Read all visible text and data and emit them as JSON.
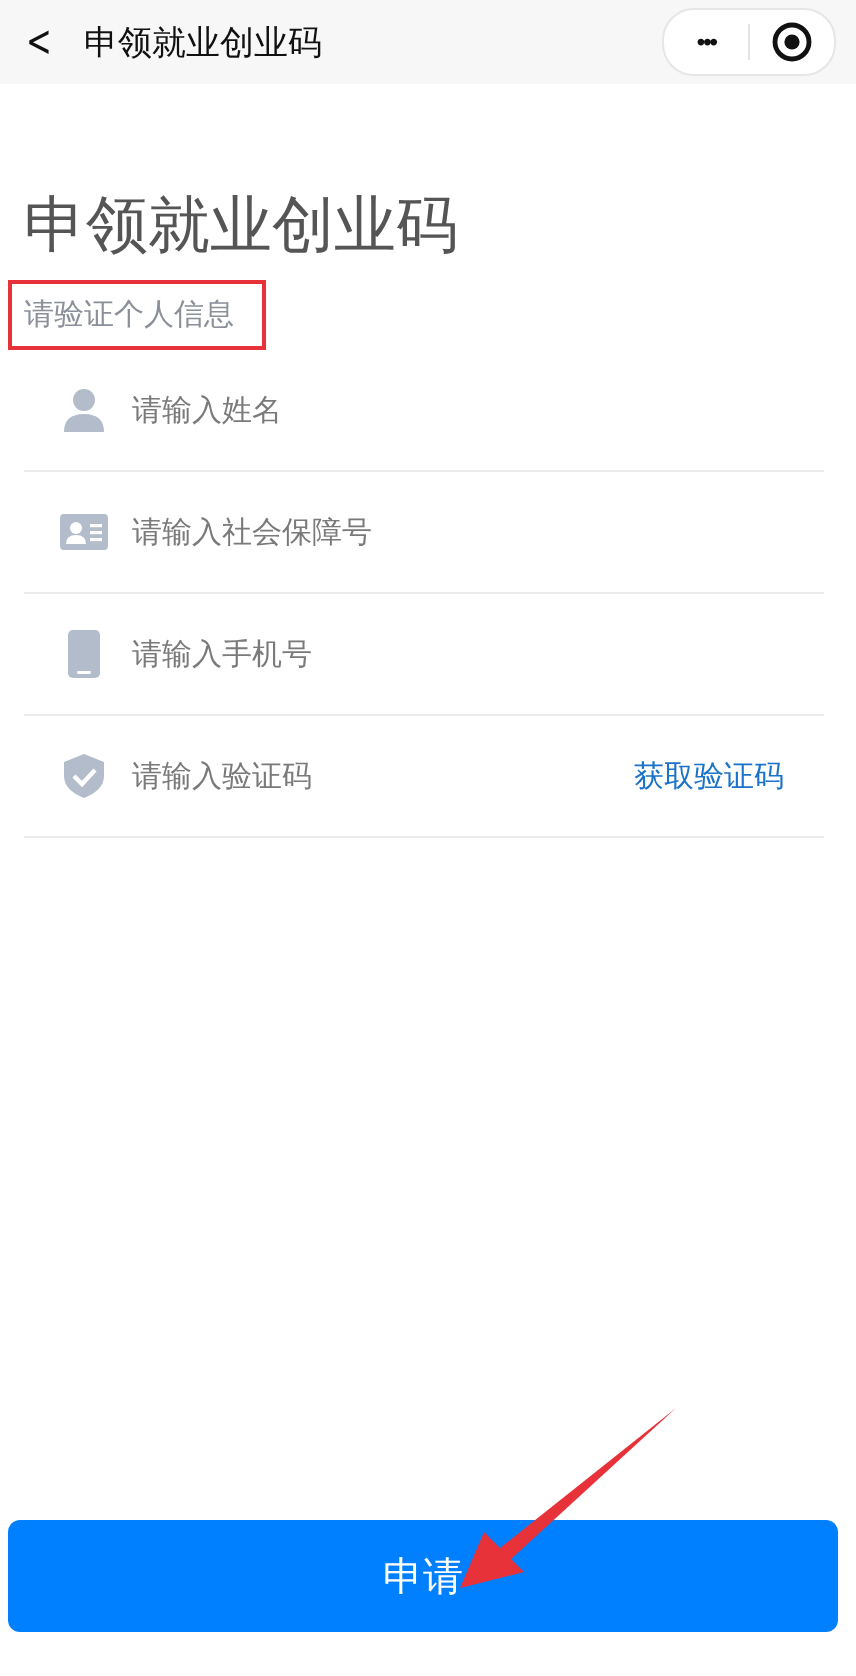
{
  "nav_bar": {
    "back": "<",
    "title": "申领就业创业码",
    "more": "•••"
  },
  "heading": "申领就业创业码",
  "subtitle": "请验证个人信息",
  "annotations": {
    "highlight_box": true,
    "arrow": true
  },
  "fields": [
    {
      "kind": "person",
      "placeholder": "请输入姓名"
    },
    {
      "kind": "card",
      "placeholder": "请输入社会保障号"
    },
    {
      "kind": "phone",
      "placeholder": "请输入手机号"
    },
    {
      "kind": "shield",
      "placeholder": "请输入验证码",
      "action": "获取验证码"
    }
  ],
  "submit": "申请"
}
